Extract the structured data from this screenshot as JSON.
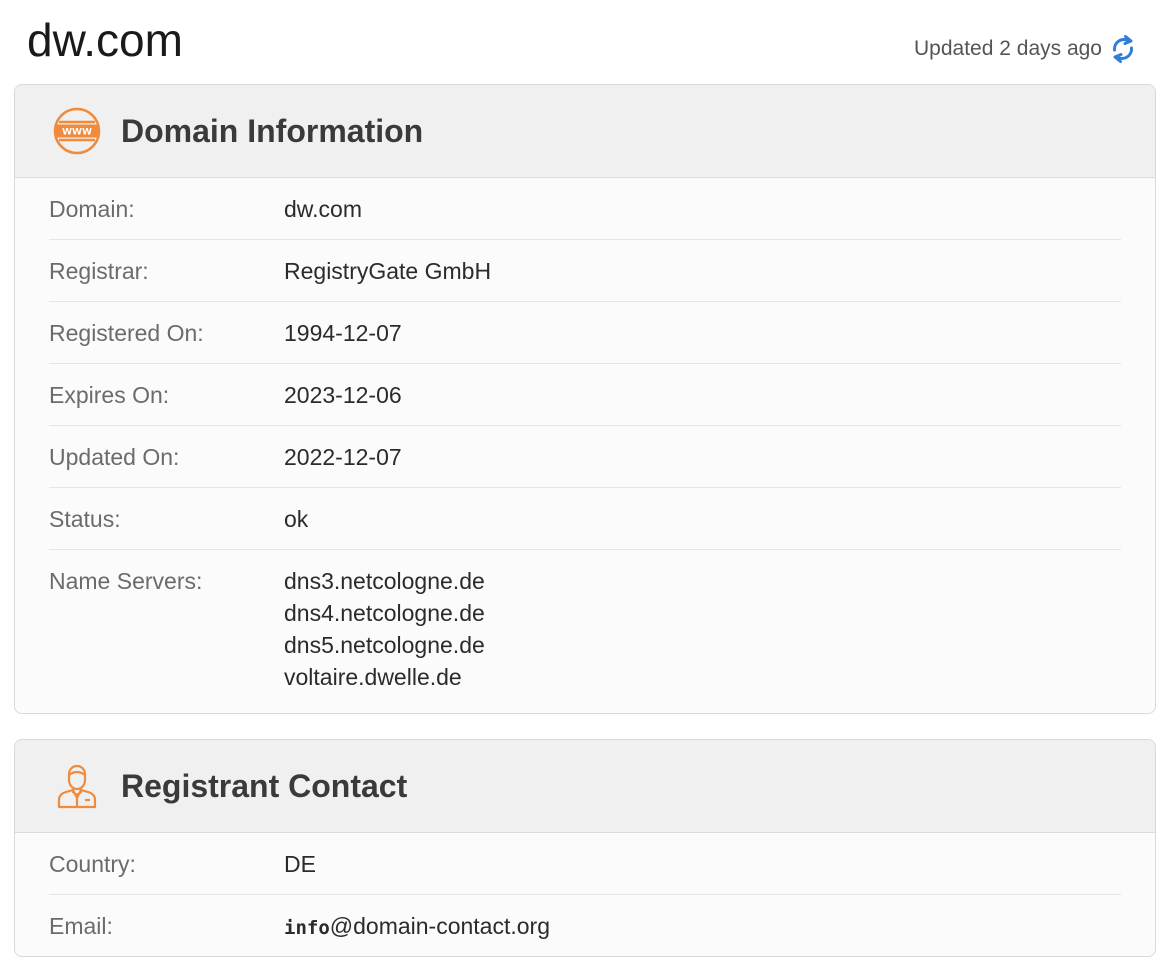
{
  "header": {
    "site_title": "dw.com",
    "updated_text": "Updated 2 days ago",
    "refresh_icon": "refresh-icon"
  },
  "colors": {
    "icon_orange": "#f08a3c",
    "refresh_blue": "#2f7fd8",
    "card_head_bg": "#f0f0f0"
  },
  "domain_info": {
    "title": "Domain Information",
    "icon": "www-globe-icon",
    "rows": [
      {
        "label": "Domain:",
        "value": "dw.com"
      },
      {
        "label": "Registrar:",
        "value": "RegistryGate GmbH"
      },
      {
        "label": "Registered On:",
        "value": "1994-12-07"
      },
      {
        "label": "Expires On:",
        "value": "2023-12-06"
      },
      {
        "label": "Updated On:",
        "value": "2022-12-07"
      },
      {
        "label": "Status:",
        "value": "ok"
      }
    ],
    "name_servers": {
      "label": "Name Servers:",
      "values": [
        "dns3.netcologne.de",
        "dns4.netcologne.de",
        "dns5.netcologne.de",
        "voltaire.dwelle.de"
      ]
    }
  },
  "registrant": {
    "title": "Registrant Contact",
    "icon": "person-icon",
    "country_label": "Country:",
    "country_value": "DE",
    "email_label": "Email:",
    "email_user": "info",
    "email_domain": "@domain-contact.org"
  }
}
